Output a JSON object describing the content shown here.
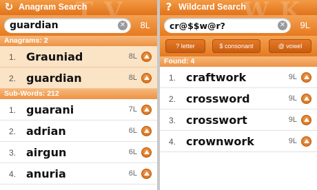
{
  "anagram_screen": {
    "title": "Anagram Search",
    "search_value": "guardian",
    "letter_count": "8L",
    "anagrams_header": "Anagrams: 2",
    "anagrams": [
      {
        "num": "1.",
        "word": "Grauniad",
        "len": "8L"
      },
      {
        "num": "2.",
        "word": "guardian",
        "len": "8L"
      }
    ],
    "subwords_header": "Sub-Words: 212",
    "subwords": [
      {
        "num": "1.",
        "word": "guarani",
        "len": "7L"
      },
      {
        "num": "2.",
        "word": "adrian",
        "len": "6L"
      },
      {
        "num": "3.",
        "word": "airgun",
        "len": "6L"
      },
      {
        "num": "4.",
        "word": "anuria",
        "len": "6L"
      }
    ]
  },
  "wildcard_screen": {
    "title": "Wildcard Search",
    "search_value": "cr@$$w@r?",
    "letter_count": "9L",
    "buttons": [
      "? letter",
      "$ consonant",
      "@ vowel"
    ],
    "found_header": "Found: 4",
    "results": [
      {
        "num": "1.",
        "word": "craftwork",
        "len": "9L"
      },
      {
        "num": "2.",
        "word": "crossword",
        "len": "9L"
      },
      {
        "num": "3.",
        "word": "crosswort",
        "len": "9L"
      },
      {
        "num": "4.",
        "word": "crownwork",
        "len": "9L"
      }
    ]
  },
  "icons": {
    "anagram": "anagram-icon",
    "wildcard": "question-icon",
    "clear": "clear-icon",
    "row_action": "go-arrow-icon"
  },
  "colors": {
    "accent": "#e57a20",
    "highlight_row": "#fbe3c6",
    "section_header": "#ec9344"
  }
}
